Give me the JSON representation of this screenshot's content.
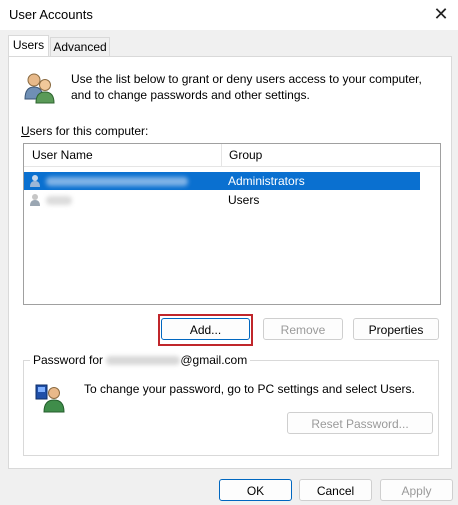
{
  "window": {
    "title": "User Accounts",
    "close_glyph": "✕"
  },
  "tabs": [
    {
      "label": "Users",
      "active": true
    },
    {
      "label": "Advanced",
      "active": false
    }
  ],
  "intro": {
    "text": "Use the list below to grant or deny users access to your computer, and to change passwords and other settings."
  },
  "users_list": {
    "label": "Users for this computer:",
    "label_accel": "U",
    "columns": [
      "User Name",
      "Group"
    ],
    "rows": [
      {
        "user": "",
        "group": "Administrators",
        "selected": true
      },
      {
        "user": "",
        "group": "Users",
        "selected": false
      }
    ]
  },
  "list_buttons": {
    "add": "Add...",
    "remove": "Remove",
    "properties": "Properties"
  },
  "password_group": {
    "legend_prefix": "Password for ",
    "legend_suffix": "@gmail.com",
    "text": "To change your password, go to PC settings and select Users.",
    "reset_button": "Reset Password..."
  },
  "footer": {
    "ok": "OK",
    "cancel": "Cancel",
    "apply": "Apply"
  },
  "colors": {
    "selection": "#0a70d0",
    "highlight_box": "#c0262b",
    "focus": "#0067c0"
  },
  "icons": {
    "intro": "users-group-icon",
    "row": "user-icon",
    "password": "user-key-icon",
    "close": "close-icon"
  }
}
